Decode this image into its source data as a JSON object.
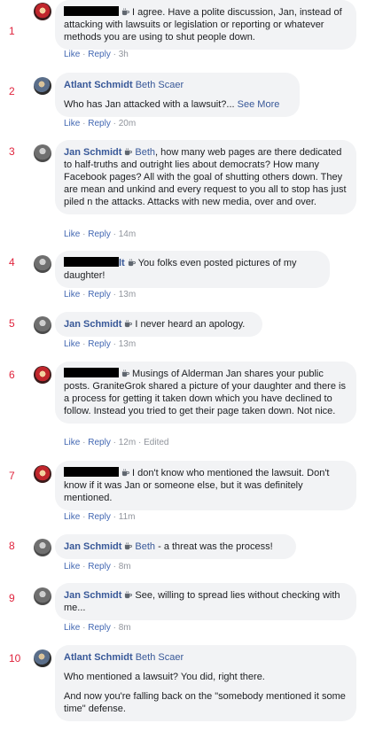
{
  "comments": [
    {
      "number": "1",
      "author": "",
      "text": "I agree. Have a polite discussion, Jan, instead of attacking with lawsuits or legislation or reporting or whatever methods you are using to shut people down.",
      "like": "Like",
      "reply": "Reply",
      "time": "3h"
    },
    {
      "number": "2",
      "author": "Atlant Schmidt",
      "mention": "Beth Scaer",
      "text": "Who has Jan attacked with a lawsuit?...",
      "see_more": "See More",
      "like": "Like",
      "reply": "Reply",
      "time": "20m"
    },
    {
      "number": "3",
      "author": "Jan Schmidt",
      "mention": "Beth",
      "text": ", how many web pages are there dedicated to half-truths and outright lies about democrats? How many Facebook pages? All with the goal of shutting others down. They are mean and unkind and every request to you all to stop has just piled n the attacks. Attacks with new media, over and over.",
      "like": "Like",
      "reply": "Reply",
      "time": "14m"
    },
    {
      "number": "4",
      "author_suffix": "lt",
      "text": "You folks even posted pictures of my daughter!",
      "like": "Like",
      "reply": "Reply",
      "time": "13m"
    },
    {
      "number": "5",
      "author": "Jan Schmidt",
      "text": "I never heard an apology.",
      "like": "Like",
      "reply": "Reply",
      "time": "13m"
    },
    {
      "number": "6",
      "text": "Musings of Alderman Jan shares your public posts. GraniteGrok shared a picture of your daughter and there is a process for getting it taken down which you have declined to follow. Instead you tried to get their page taken down. Not nice.",
      "like": "Like",
      "reply": "Reply",
      "time": "12m",
      "edited": "Edited"
    },
    {
      "number": "7",
      "text": "I don't know who mentioned the lawsuit. Don't know if it was Jan or someone else, but it was definitely mentioned.",
      "like": "Like",
      "reply": "Reply",
      "time": "11m"
    },
    {
      "number": "8",
      "author": "Jan Schmidt",
      "mention": "Beth",
      "text": "- a threat was the process!",
      "like": "Like",
      "reply": "Reply",
      "time": "8m"
    },
    {
      "number": "9",
      "author": "Jan Schmidt",
      "text": "See, willing to spread lies without checking with me...",
      "like": "Like",
      "reply": "Reply",
      "time": "8m"
    },
    {
      "number": "10",
      "author": "Atlant Schmidt",
      "mention": "Beth Scaer",
      "text": "Who mentioned a lawsuit? You did, right there.",
      "text2": "And now you're falling back on the \"somebody mentioned it some time\" defense."
    }
  ],
  "separator": "·",
  "icons": {
    "badge": "coffee-cup-icon"
  }
}
